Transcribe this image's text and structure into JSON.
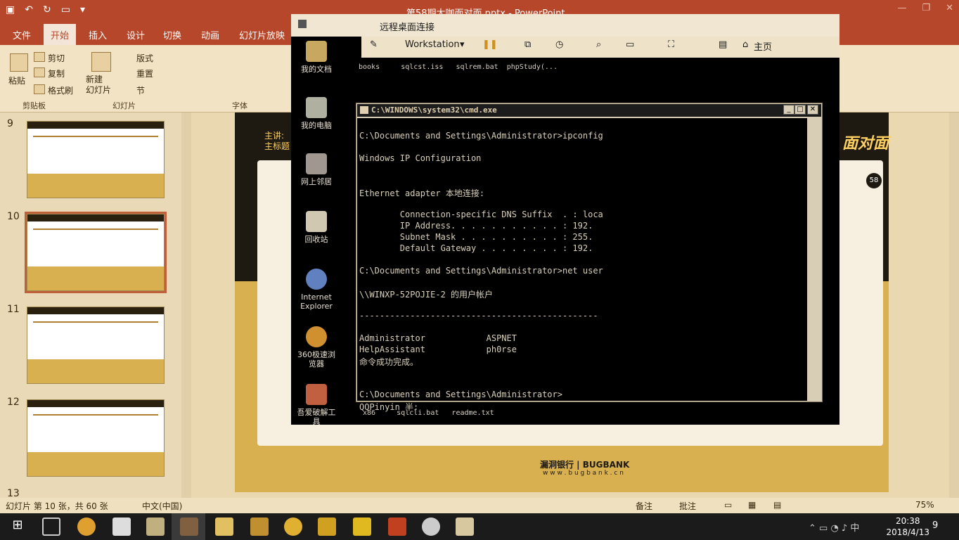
{
  "ppt": {
    "doc_title": "第58期大咖面对面.pptx - PowerPoint",
    "tabs": [
      "文件",
      "开始",
      "插入",
      "设计",
      "切换",
      "动画",
      "幻灯片放映"
    ],
    "ribbon": {
      "paste": "粘贴",
      "cut": "剪切",
      "copy": "复制",
      "format_painter": "格式刷",
      "new_slide": "新建\n幻灯片",
      "layout": "版式",
      "reset": "重置",
      "section": "节",
      "group_clipboard": "剪贴板",
      "group_slides": "幻灯片",
      "group_font": "字体"
    },
    "thumb_numbers": [
      "9",
      "10",
      "11",
      "12",
      "13"
    ],
    "slide": {
      "speaker": "主讲:\n主标题",
      "right_text": "面对面",
      "badge": "58",
      "logo_text": "漏洞银行 | BUGBANK",
      "logo_url": "w w w . b u g b a n k . c n"
    },
    "status": {
      "slide_count": "幻灯片 第 10 张，共 60 张",
      "language": "中文(中国)",
      "notes": "备注",
      "comments": "批注",
      "zoom": "75%"
    }
  },
  "rdp": {
    "title": "远程桌面连接",
    "workstation": "Workstation",
    "home": "主页",
    "desktop_icons": [
      "我的文档",
      "我的电脑",
      "网上邻居",
      "回收站",
      "Internet Explorer",
      "360极速浏览器",
      "吾爱破解工具"
    ],
    "files_top": "books     sqlcst.iss   sqlrem.bat  phpStudy(...",
    "files_bottom": "x86     sqlcli.bat   readme.txt"
  },
  "cmd": {
    "title": "C:\\WINDOWS\\system32\\cmd.exe",
    "lines": [
      "C:\\Documents and Settings\\Administrator>ipconfig",
      "",
      "Windows IP Configuration",
      "",
      "",
      "Ethernet adapter 本地连接:",
      "",
      "        Connection-specific DNS Suffix  . : loca",
      "        IP Address. . . . . . . . . . . : 192.",
      "        Subnet Mask . . . . . . . . . . : 255.",
      "        Default Gateway . . . . . . . . : 192.",
      "",
      "C:\\Documents and Settings\\Administrator>net user",
      "",
      "\\\\WINXP-52POJIE-2 的用户帐户",
      "",
      "-----------------------------------------------",
      "",
      "Administrator            ASPNET",
      "HelpAssistant            ph0rse",
      "命令成功完成。",
      "",
      "",
      "C:\\Documents and Settings\\Administrator>",
      "QQPinyin 半:"
    ]
  },
  "taskbar": {
    "time": "20:38",
    "date": "2018/4/13",
    "notification_count": "9"
  },
  "colors": {
    "ppt_accent": "#b7472a",
    "slide_gold": "#d8b050",
    "slide_dark": "#1e1a12"
  }
}
